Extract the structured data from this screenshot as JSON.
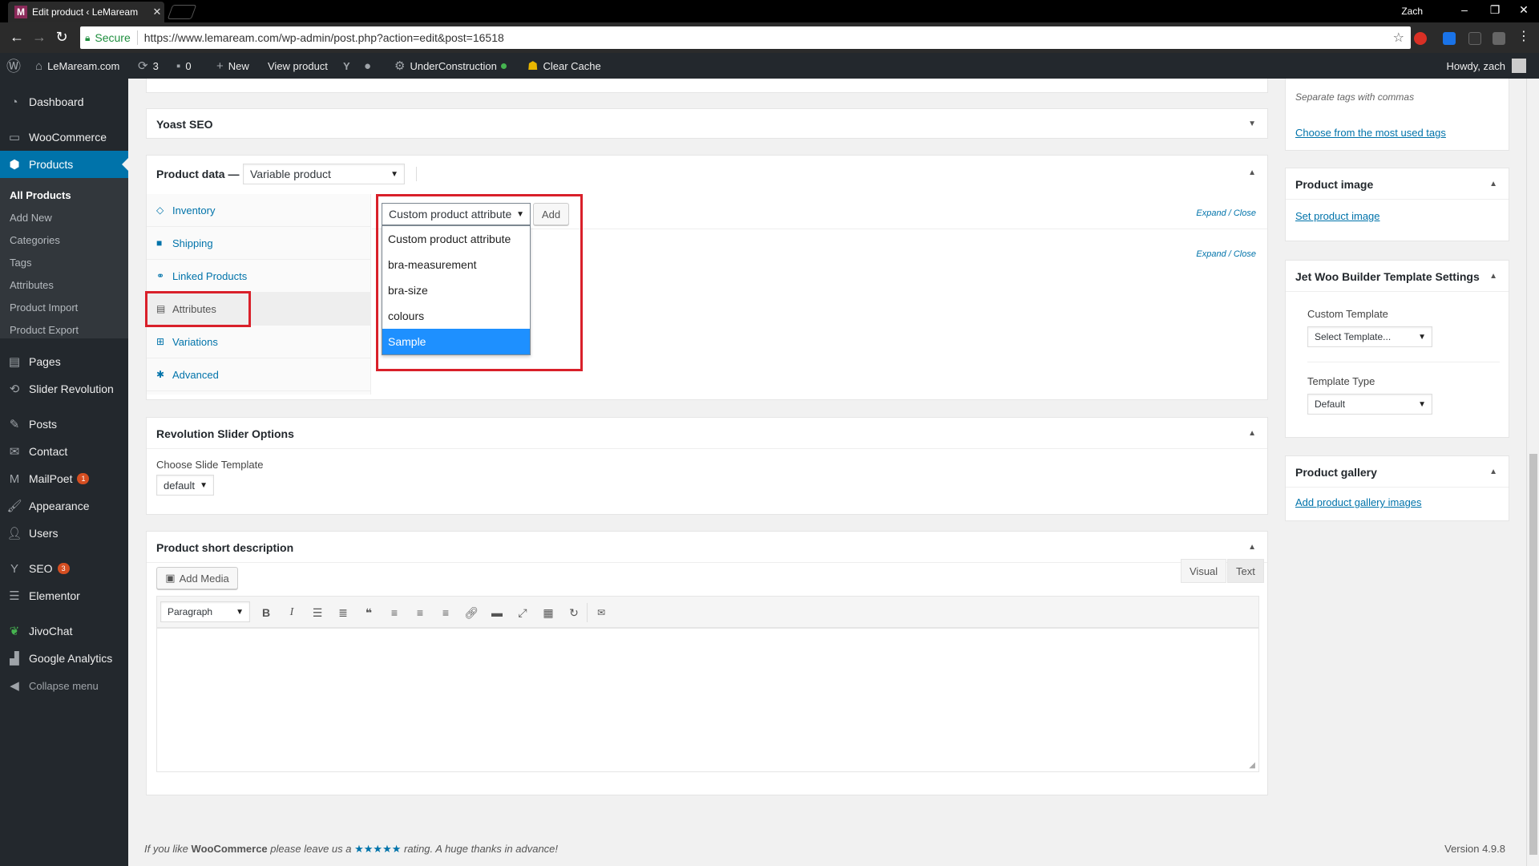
{
  "browser": {
    "tab_title": "Edit product ‹ LeMaream",
    "tab_favicon": "M",
    "user": "Zach",
    "secure_label": "Secure",
    "url": "https://www.lemaream.com/wp-admin/post.php?action=edit&post=16518"
  },
  "adminbar": {
    "site_name": "LeMaream.com",
    "updates_count": "3",
    "comments_count": "0",
    "new_label": "New",
    "view_product": "View product",
    "under_construction": "UnderConstruction",
    "clear_cache": "Clear Cache",
    "howdy": "Howdy, zach"
  },
  "menu": {
    "dashboard": "Dashboard",
    "woocommerce": "WooCommerce",
    "products": "Products",
    "sub": {
      "all_products": "All Products",
      "add_new": "Add New",
      "categories": "Categories",
      "tags": "Tags",
      "attributes": "Attributes",
      "product_import": "Product Import",
      "product_export": "Product Export"
    },
    "pages": "Pages",
    "slider_revolution": "Slider Revolution",
    "posts": "Posts",
    "contact": "Contact",
    "mailpoet": "MailPoet",
    "mailpoet_badge": "1",
    "appearance": "Appearance",
    "users": "Users",
    "seo": "SEO",
    "seo_badge": "3",
    "elementor": "Elementor",
    "jivochat": "JivoChat",
    "google_analytics": "Google Analytics",
    "collapse": "Collapse menu"
  },
  "main": {
    "yoast_title": "Yoast SEO",
    "product_data_label": "Product data —",
    "product_type": "Variable product",
    "tabs": [
      {
        "label": "Inventory"
      },
      {
        "label": "Shipping"
      },
      {
        "label": "Linked Products"
      },
      {
        "label": "Attributes"
      },
      {
        "label": "Variations"
      },
      {
        "label": "Advanced"
      }
    ],
    "attribute_select_value": "Custom product attribute",
    "add_button": "Add",
    "expand_close_1": "Expand / Close",
    "expand_close_2": "Expand / Close",
    "dropdown_options": [
      {
        "label": "Custom product attribute"
      },
      {
        "label": "bra-measurement"
      },
      {
        "label": "bra-size"
      },
      {
        "label": "colours"
      },
      {
        "label": "Sample"
      }
    ],
    "rev_slider_title": "Revolution Slider Options",
    "choose_slide_template": "Choose Slide Template",
    "slide_template_value": "default",
    "short_desc_title": "Product short description",
    "add_media": "Add Media",
    "tab_visual": "Visual",
    "tab_text": "Text",
    "paragraph": "Paragraph"
  },
  "sidebar": {
    "tags_hint": "Separate tags with commas",
    "most_used_tags": "Choose from the most used tags",
    "product_image_title": "Product image",
    "set_product_image": "Set product image",
    "jet_title": "Jet Woo Builder Template Settings",
    "custom_template_label": "Custom Template",
    "custom_template_value": "Select Template...",
    "template_type_label": "Template Type",
    "template_type_value": "Default",
    "gallery_title": "Product gallery",
    "add_gallery_images": "Add product gallery images"
  },
  "footer": {
    "text_before": "If you like",
    "brand": "WooCommerce",
    "text_mid": "please leave us a",
    "stars": "★★★★★",
    "text_after": "rating. A huge thanks in advance!",
    "version": "Version 4.9.8"
  },
  "colors": {
    "admin_dark": "#23282d",
    "wp_blue": "#0073aa",
    "highlight_red": "#d9202a",
    "selected_option": "#1e90ff"
  }
}
